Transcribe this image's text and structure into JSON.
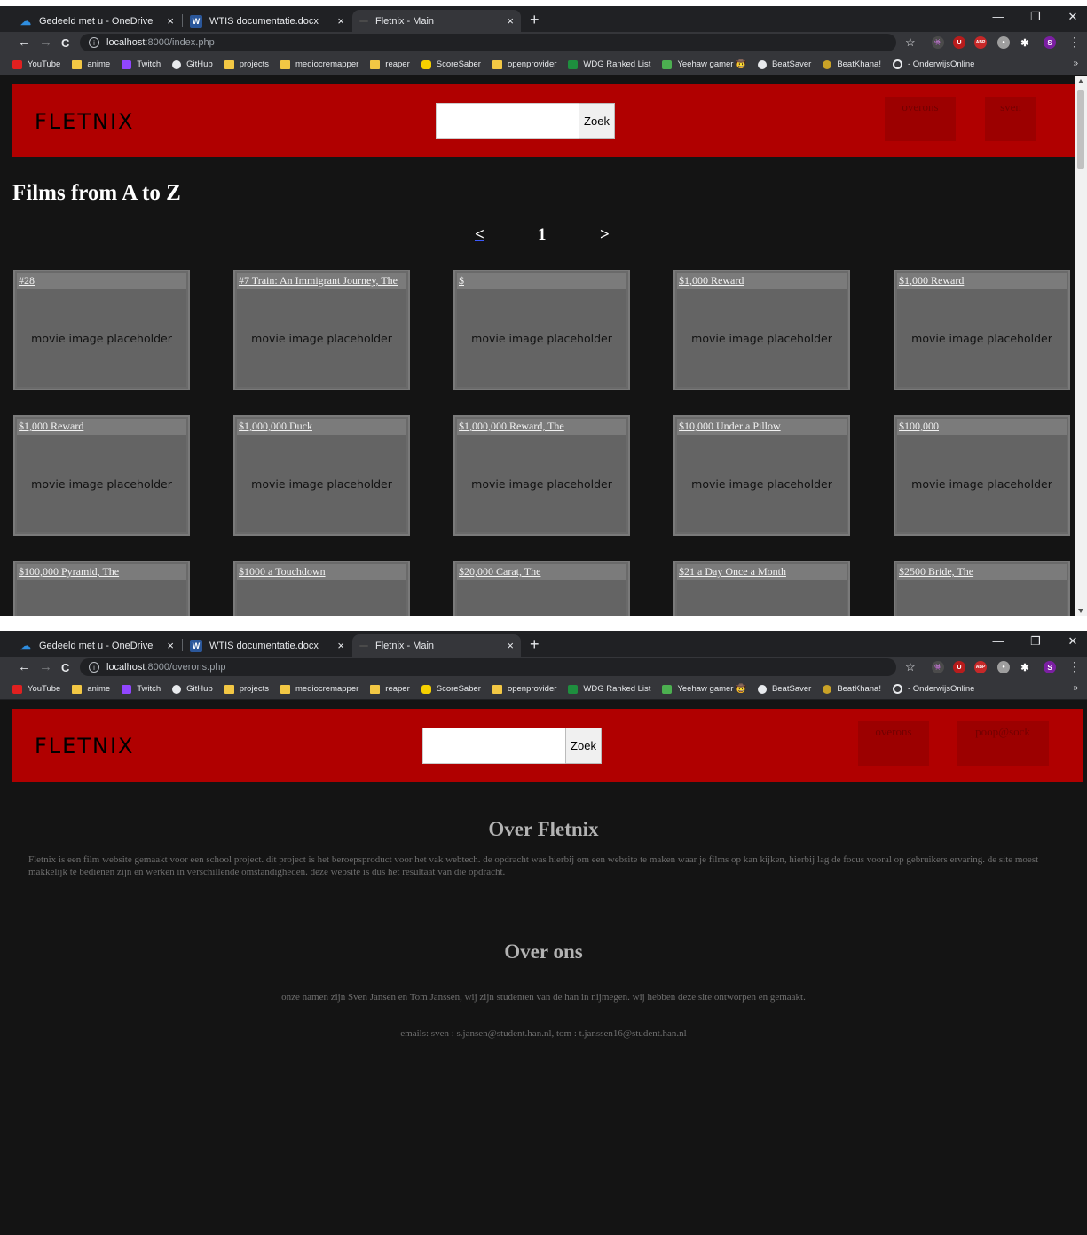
{
  "browser": {
    "tabs": [
      {
        "title": "Gedeeld met u - OneDrive",
        "icon": "onedrive-icon"
      },
      {
        "title": "WTIS documentatie.docx",
        "icon": "word-icon"
      },
      {
        "title": "Fletnix - Main",
        "icon": "page-icon"
      }
    ],
    "close_glyph": "×",
    "newtab_glyph": "+",
    "window_controls": [
      "—",
      "❐",
      "✕"
    ],
    "url_host": "localhost",
    "url_path_index": ":8000/index.php",
    "url_path_overons": ":8000/overons.php",
    "info_glyph": "i",
    "nav_glyphs": {
      "back": "←",
      "forward": "→",
      "reload": "C"
    },
    "star_glyph": "☆",
    "extensions": [
      {
        "label": "👾",
        "color": "#4b4b4b"
      },
      {
        "label": "U",
        "color": "#b71c1c"
      },
      {
        "label": "ABP",
        "color": "#c62828"
      },
      {
        "label": "●",
        "color": "#9e9e9e"
      },
      {
        "label": "✱",
        "color": "#35363a"
      },
      {
        "label": "S",
        "color": "#7b1fa2"
      }
    ],
    "menu_glyph": "⋮",
    "bookmarks": [
      {
        "label": "YouTube",
        "kind": "youtube"
      },
      {
        "label": "anime",
        "kind": "folder"
      },
      {
        "label": "Twitch",
        "kind": "twitch"
      },
      {
        "label": "GitHub",
        "kind": "github"
      },
      {
        "label": "projects",
        "kind": "folder"
      },
      {
        "label": "mediocremapper",
        "kind": "folder"
      },
      {
        "label": "reaper",
        "kind": "folder"
      },
      {
        "label": "ScoreSaber",
        "kind": "scoresaber"
      },
      {
        "label": "openprovider",
        "kind": "folder"
      },
      {
        "label": "WDG Ranked List",
        "kind": "sheets"
      },
      {
        "label": "Yeehaw gamer 🤠",
        "kind": "yeehaw"
      },
      {
        "label": "BeatSaver",
        "kind": "beatsaver"
      },
      {
        "label": "BeatKhana!",
        "kind": "beatkhana"
      },
      {
        "label": "- OnderwijsOnline",
        "kind": "onderwijs"
      }
    ],
    "more_glyph": "»"
  },
  "site": {
    "logo": "FLETNIX",
    "search_button": "Zoek",
    "nav_overons": "overons",
    "nav_user_index": "sven",
    "nav_user_overons": "poop@sock"
  },
  "index": {
    "heading": "Films from A to Z",
    "pager": {
      "prev": "<",
      "page": "1",
      "next": ">"
    },
    "placeholder": "movie image placeholder",
    "movies": [
      "#28",
      "#7 Train: An Immigrant Journey, The",
      "$",
      "$1,000 Reward",
      "$1,000 Reward",
      "$1,000 Reward",
      "$1,000,000 Duck",
      "$1,000,000 Reward, The",
      "$10,000 Under a Pillow",
      "$100,000",
      "$100,000 Pyramid, The",
      "$1000 a Touchdown",
      "$20,000 Carat, The",
      "$21 a Day Once a Month",
      "$2500 Bride, The"
    ]
  },
  "overons": {
    "title_fletnix": "Over Fletnix",
    "fletnix_text": "Fletnix is een film website gemaakt voor een school project. dit project is het beroepsproduct voor het vak webtech. de opdracht was hierbij om een website te maken waar je films op kan kijken, hierbij lag de focus vooral op gebruikers ervaring. de site moest makkelijk te bedienen zijn en werken in verschillende omstandigheden. deze website is dus het resultaat van die opdracht.",
    "title_ons": "Over ons",
    "ons_text": "onze namen zijn Sven Jansen en Tom Janssen, wij zijn studenten van de han in nijmegen. wij hebben deze site ontworpen en gemaakt.",
    "emails_text": "emails: sven : s.jansen@student.han.nl, tom : t.janssen16@student.han.nl"
  },
  "colors": {
    "header_red": "#b00000",
    "page_bg": "#141414",
    "card_bg": "#6a6a6a"
  }
}
